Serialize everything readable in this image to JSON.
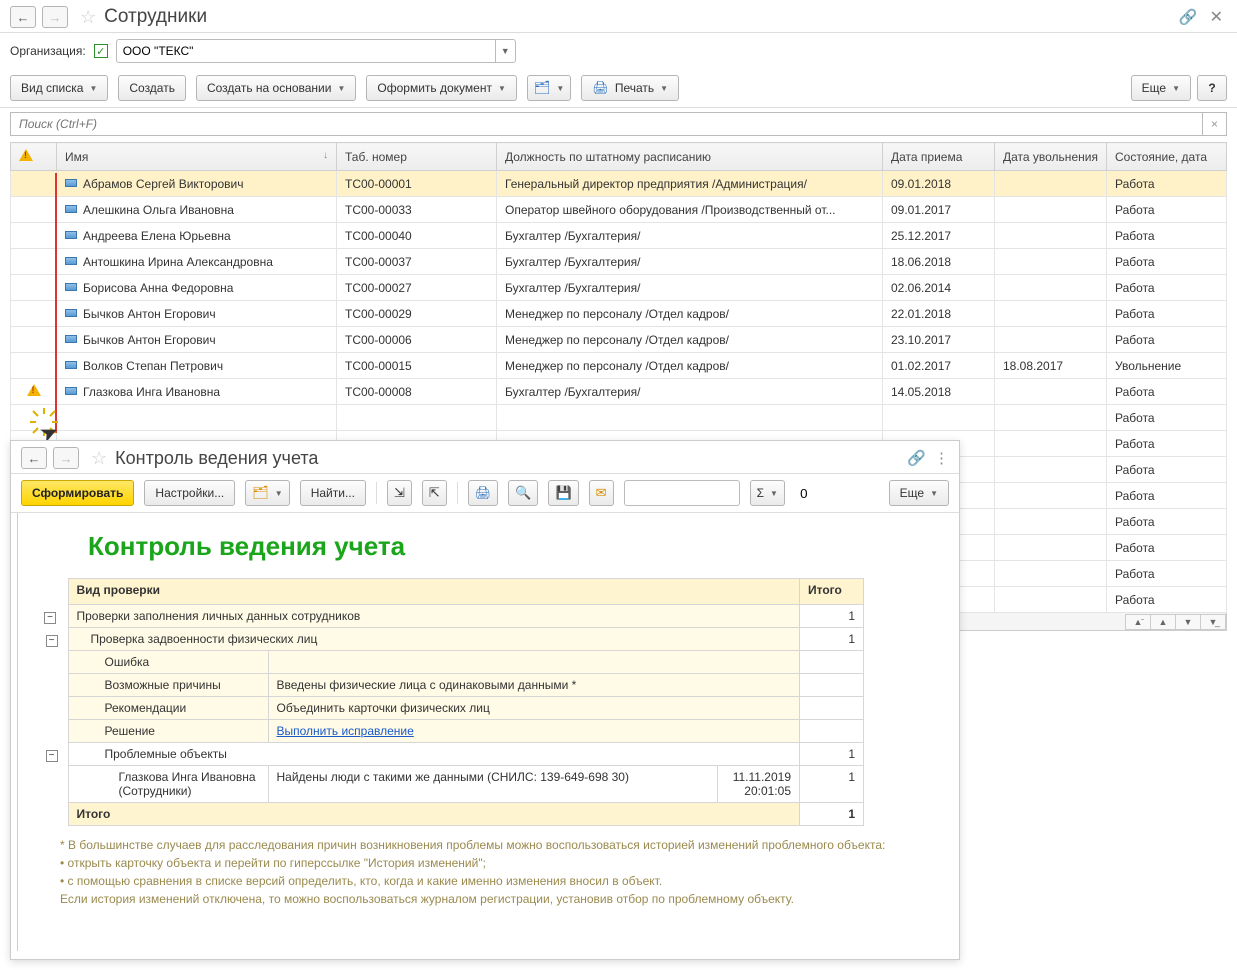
{
  "header": {
    "title": "Сотрудники",
    "org_label": "Организация:",
    "org_value": "ООО \"ТЕКС\""
  },
  "toolbar": {
    "view_type": "Вид списка",
    "create": "Создать",
    "create_based": "Создать на основании",
    "doc": "Оформить документ",
    "print": "Печать",
    "more": "Еще",
    "help": "?"
  },
  "search": {
    "placeholder": "Поиск (Ctrl+F)"
  },
  "columns": {
    "name": "Имя",
    "tab": "Таб. номер",
    "pos": "Должность по штатному расписанию",
    "hire": "Дата приема",
    "fire": "Дата увольнения",
    "state": "Состояние, дата"
  },
  "rows": [
    {
      "warn": false,
      "name": "Абрамов Сергей Викторович",
      "tab": "ТС00-00001",
      "pos": "Генеральный директор предприятия /Администрация/",
      "hire": "09.01.2018",
      "fire": "",
      "state": "Работа",
      "sel": true
    },
    {
      "warn": false,
      "name": "Алешкина Ольга Ивановна",
      "tab": "ТС00-00033",
      "pos": "Оператор швейного оборудования /Производственный от...",
      "hire": "09.01.2017",
      "fire": "",
      "state": "Работа"
    },
    {
      "warn": false,
      "name": "Андреева Елена Юрьевна",
      "tab": "ТС00-00040",
      "pos": "Бухгалтер /Бухгалтерия/",
      "hire": "25.12.2017",
      "fire": "",
      "state": "Работа"
    },
    {
      "warn": false,
      "name": "Антошкина Ирина Александровна",
      "tab": "ТС00-00037",
      "pos": "Бухгалтер /Бухгалтерия/",
      "hire": "18.06.2018",
      "fire": "",
      "state": "Работа"
    },
    {
      "warn": false,
      "name": "Борисова Анна Федоровна",
      "tab": "ТС00-00027",
      "pos": "Бухгалтер /Бухгалтерия/",
      "hire": "02.06.2014",
      "fire": "",
      "state": "Работа"
    },
    {
      "warn": false,
      "name": "Бычков Антон Егорович",
      "tab": "ТС00-00029",
      "pos": "Менеджер по персоналу /Отдел кадров/",
      "hire": "22.01.2018",
      "fire": "",
      "state": "Работа"
    },
    {
      "warn": false,
      "name": "Бычков Антон Егорович",
      "tab": "ТС00-00006",
      "pos": "Менеджер по персоналу /Отдел кадров/",
      "hire": "23.10.2017",
      "fire": "",
      "state": "Работа"
    },
    {
      "warn": false,
      "name": "Волков Степан Петрович",
      "tab": "ТС00-00015",
      "pos": "Менеджер по персоналу /Отдел кадров/",
      "hire": "01.02.2017",
      "fire": "18.08.2017",
      "state": "Увольнение"
    },
    {
      "warn": true,
      "name": "Глазкова Инга Ивановна",
      "tab": "ТС00-00008",
      "pos": "Бухгалтер /Бухгалтерия/",
      "hire": "14.05.2018",
      "fire": "",
      "state": "Работа"
    },
    {
      "warn": false,
      "name": "",
      "tab": "",
      "pos": "",
      "hire": "",
      "fire": "",
      "state": "Работа"
    },
    {
      "warn": false,
      "name": "",
      "tab": "",
      "pos": "",
      "hire": "",
      "fire": "",
      "state": "Работа"
    },
    {
      "warn": false,
      "name": "",
      "tab": "",
      "pos": "",
      "hire": "",
      "fire": "",
      "state": "Работа"
    },
    {
      "warn": false,
      "name": "",
      "tab": "",
      "pos": "",
      "hire": "",
      "fire": "",
      "state": "Работа"
    },
    {
      "warn": false,
      "name": "",
      "tab": "",
      "pos": "",
      "hire": "",
      "fire": "",
      "state": "Работа"
    },
    {
      "warn": false,
      "name": "",
      "tab": "",
      "pos": "",
      "hire": "",
      "fire": "",
      "state": "Работа"
    },
    {
      "warn": false,
      "name": "",
      "tab": "",
      "pos": "",
      "hire": "",
      "fire": "",
      "state": "Работа"
    },
    {
      "warn": false,
      "name": "",
      "tab": "",
      "pos": "",
      "hire": "",
      "fire": "",
      "state": "Работа"
    }
  ],
  "win2": {
    "title": "Контроль ведения учета",
    "form": "Сформировать",
    "settings": "Настройки...",
    "find": "Найти...",
    "more": "Еще",
    "num_value": "0",
    "report_title": "Контроль ведения учета",
    "th_kind": "Вид проверки",
    "th_total": "Итого",
    "r1": "Проверки заполнения личных данных сотрудников",
    "r1_total": "1",
    "r2": "Проверка задвоенности физических лиц",
    "r2_total": "1",
    "err": "Ошибка",
    "reasons_l": "Возможные причины",
    "reasons_v": "Введены физические лица с одинаковыми данными *",
    "rec_l": "Рекомендации",
    "rec_v": "Объединить карточки физических лиц",
    "sol_l": "Решение",
    "sol_v": "Выполнить исправление",
    "probl": "Проблемные объекты",
    "probl_total": "1",
    "obj_name": "Глазкова Инга Ивановна (Сотрудники)",
    "obj_found": "Найдены люди с такими же данными (СНИЛС: 139-649-698 30)",
    "obj_dt1": "11.11.2019",
    "obj_dt2": "20:01:05",
    "obj_total": "1",
    "grand": "Итого",
    "grand_total": "1",
    "note1": "* В большинстве случаев для расследования причин возникновения проблемы можно воспользоваться историей изменений проблемного объекта:",
    "note2": "• открыть карточку объекта и перейти по гиперссылке \"История изменений\";",
    "note3": "• с помощью сравнения в списке версий определить, кто, когда и какие именно изменения вносил в объект.",
    "note4": "Если история изменений отключена, то можно воспользоваться журналом регистрации, установив отбор по проблемному объекту."
  }
}
